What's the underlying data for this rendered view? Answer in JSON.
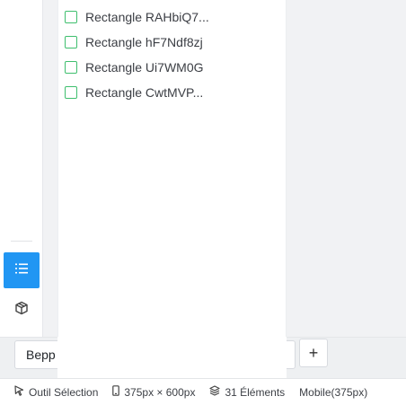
{
  "layers": {
    "items": [
      {
        "label": "Rectangle RAHbiQ7..."
      },
      {
        "label": "Rectangle hF7Ndf8zj"
      },
      {
        "label": "Rectangle Ui7WM0G"
      },
      {
        "label": "Rectangle CwtMVP..."
      }
    ],
    "check_color": "#3fbf6e"
  },
  "rail": {
    "active_icon": "list-icon",
    "secondary_icon": "cube-icon",
    "accent": "#2196f3"
  },
  "editor": {
    "name_value": "Bepp",
    "add_label": "+"
  },
  "status": {
    "tool": "Outil Sélection",
    "size": "375px × 600px",
    "elements": "31 Éléments",
    "viewport": "Mobile(375px)"
  }
}
